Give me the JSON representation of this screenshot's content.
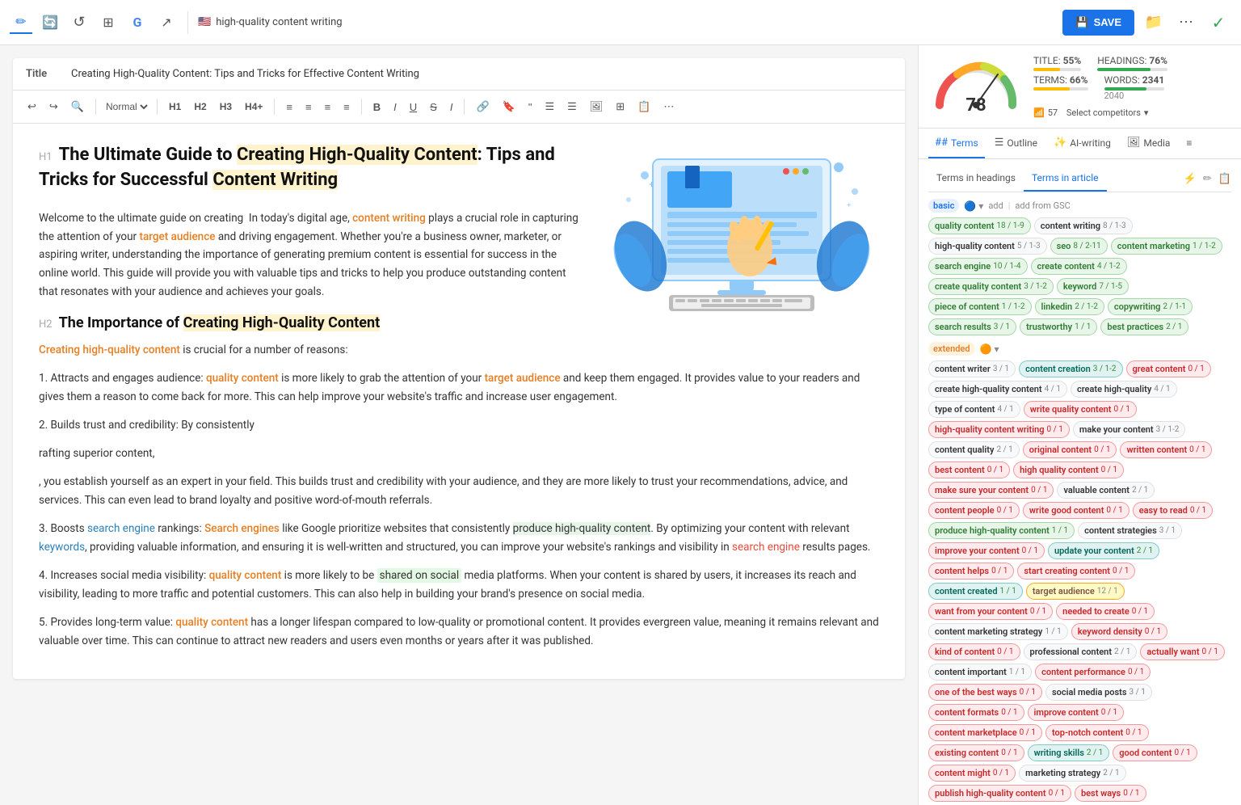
{
  "topbar": {
    "icons": [
      {
        "name": "pen-icon",
        "symbol": "✏️",
        "active": true
      },
      {
        "name": "refresh-icon",
        "symbol": "🔄",
        "active": false
      },
      {
        "name": "history-icon",
        "symbol": "↺",
        "active": false
      },
      {
        "name": "grid-icon",
        "symbol": "⊞",
        "active": false
      },
      {
        "name": "google-icon",
        "symbol": "G",
        "active": false
      },
      {
        "name": "share-icon",
        "symbol": "↗",
        "active": false
      }
    ],
    "flag": "🇺🇸",
    "document_title": "high-quality content writing",
    "save_label": "SAVE",
    "folder_icon": "📁",
    "more_icon": "⋯",
    "check_icon": "✓"
  },
  "title_bar": {
    "label": "Title",
    "value": "Creating High-Quality Content: Tips and Tricks for Effective Content Writing"
  },
  "toolbar": {
    "undo": "↩",
    "redo": "↪",
    "search": "🔍",
    "format": "Normal",
    "h1": "H1",
    "h2": "H2",
    "h3": "H3",
    "h4": "H4+",
    "align_left": "≡",
    "align_center": "≡",
    "align_right": "≡",
    "align_justify": "≡",
    "bold": "B",
    "italic": "I",
    "underline": "U",
    "strikethrough": "S",
    "more": "⋯"
  },
  "content": {
    "h1": "The Ultimate Guide to Creating High-Quality Content: Tips and Tricks for Successful Content Writing",
    "intro": "Welcome to the ultimate guide on creating  In today's digital age, content writing plays a crucial role in capturing the attention of your target audience and driving engagement. Whether you're a business owner, marketer, or aspiring writer, understanding the importance of generating premium content is essential for success in the online world. This guide will provide you with valuable tips and tricks to help you produce outstanding content that resonates with your audience and achieves your goals.",
    "h2": "The Importance of Creating High-Quality Content",
    "body1": "Creating high-quality content is crucial for a number of reasons:",
    "list": [
      "Attracts and engages audience: quality content is more likely to grab the attention of your target audience and keep them engaged. It provides value to your readers and gives them a reason to come back for more. This can help improve your website's traffic and increase user engagement.",
      "Builds trust and credibility: By consistently"
    ],
    "body2": "rafting superior content,",
    "body3": ", you establish yourself as an expert in your field. This builds trust and credibility with your audience, and they are more likely to trust your recommendations, advice, and services. This can even lead to brand loyalty and positive word-of-mouth referrals.",
    "body4": "3. Boosts search engine rankings: Search engines like Google prioritize websites that consistently produce high-quality content. By optimizing your content with relevant keywords, providing valuable information, and ensuring it is well-written and structured, you can improve your website's rankings and visibility in search engine results pages.",
    "body5": "4. Increases social media visibility: quality content is more likely to be shared on social media platforms. When your content is shared by users, it increases its reach and visibility, leading to more traffic and potential customers. This can also help in building your brand's presence on social media.",
    "body6": "5. Provides long-term value: quality content has a longer lifespan compared to low-quality or promotional content. It provides evergreen value, meaning it remains relevant and valuable over time. This can continue to attract new readers and users even months or years after it was published."
  },
  "score": {
    "value": 78,
    "wifi_label": "57",
    "title_pct": "55%",
    "headings_pct": "76%",
    "terms_pct": "66%",
    "words": "2341",
    "words_sub": "2040",
    "select_competitors": "Select competitors"
  },
  "panel_tabs": [
    {
      "label": "Terms",
      "icon": "##",
      "active": true
    },
    {
      "label": "Outline",
      "icon": "☰"
    },
    {
      "label": "AI-writing",
      "icon": "✨"
    },
    {
      "label": "Media",
      "icon": "🖼"
    },
    {
      "label": "≡",
      "icon": ""
    }
  ],
  "terms_subtabs": [
    {
      "label": "Terms in headings"
    },
    {
      "label": "Terms in article",
      "active": true
    }
  ],
  "basic_terms": [
    {
      "key": "quality content",
      "count": "18",
      "range": "1-9",
      "style": "green"
    },
    {
      "key": "content writing",
      "count": "8",
      "range": "1-3",
      "style": "white"
    },
    {
      "key": "high-quality content",
      "count": "5",
      "range": "1-3",
      "style": "white"
    },
    {
      "key": "seo",
      "count": "8",
      "range": "2-11",
      "style": "green"
    },
    {
      "key": "content marketing",
      "count": "1",
      "range": "1-2",
      "style": "green"
    },
    {
      "key": "search engine",
      "count": "10",
      "range": "1-4",
      "style": "green"
    },
    {
      "key": "create content",
      "count": "4",
      "range": "1-2",
      "style": "green"
    },
    {
      "key": "create quality content",
      "count": "3",
      "range": "1-2",
      "style": "green"
    },
    {
      "key": "keyword",
      "count": "7",
      "range": "1-5",
      "style": "green"
    },
    {
      "key": "piece of content",
      "count": "1",
      "range": "1-2",
      "style": "green"
    },
    {
      "key": "linkedin",
      "count": "2",
      "range": "1-2",
      "style": "green"
    },
    {
      "key": "copywriting",
      "count": "2",
      "range": "1-1",
      "style": "green"
    },
    {
      "key": "search results",
      "count": "3",
      "range": "1-1",
      "style": "green"
    },
    {
      "key": "trustworthy",
      "count": "1",
      "range": "1",
      "style": "green"
    },
    {
      "key": "best practices",
      "count": "2",
      "range": "1",
      "style": "green"
    }
  ],
  "extended_terms": [
    {
      "key": "content writer",
      "count": "3",
      "range": "1",
      "style": "white"
    },
    {
      "key": "content creation",
      "count": "3",
      "range": "1-2",
      "style": "teal"
    },
    {
      "key": "great content",
      "count": "0",
      "range": "1",
      "style": "red"
    },
    {
      "key": "create high-quality content",
      "count": "4",
      "range": "1",
      "style": "white"
    },
    {
      "key": "create high-quality",
      "count": "4",
      "range": "1",
      "style": "white"
    },
    {
      "key": "type of content",
      "count": "4",
      "range": "1",
      "style": "white"
    },
    {
      "key": "write quality content",
      "count": "0",
      "range": "1",
      "style": "red"
    },
    {
      "key": "high-quality content writing",
      "count": "0",
      "range": "1",
      "style": "red"
    },
    {
      "key": "make your content",
      "count": "3",
      "range": "1-2",
      "style": "white"
    },
    {
      "key": "content quality",
      "count": "2",
      "range": "1",
      "style": "white"
    },
    {
      "key": "original content",
      "count": "0",
      "range": "1",
      "style": "red"
    },
    {
      "key": "written content",
      "count": "0",
      "range": "1",
      "style": "red"
    },
    {
      "key": "best content",
      "count": "0",
      "range": "1",
      "style": "red"
    },
    {
      "key": "high quality content",
      "count": "0",
      "range": "1",
      "style": "red"
    },
    {
      "key": "make sure your content",
      "count": "0",
      "range": "1",
      "style": "red"
    },
    {
      "key": "valuable content",
      "count": "2",
      "range": "1",
      "style": "white"
    },
    {
      "key": "content people",
      "count": "0",
      "range": "1",
      "style": "red"
    },
    {
      "key": "write good content",
      "count": "0",
      "range": "1",
      "style": "red"
    },
    {
      "key": "easy to read",
      "count": "0",
      "range": "1",
      "style": "red"
    },
    {
      "key": "produce high-quality content",
      "count": "1",
      "range": "1",
      "style": "green"
    },
    {
      "key": "content strategies",
      "count": "3",
      "range": "1",
      "style": "white"
    },
    {
      "key": "improve your content",
      "count": "0",
      "range": "1",
      "style": "red"
    },
    {
      "key": "update your content",
      "count": "2",
      "range": "1",
      "style": "teal"
    },
    {
      "key": "content helps",
      "count": "0",
      "range": "1",
      "style": "red"
    },
    {
      "key": "start creating content",
      "count": "0",
      "range": "1",
      "style": "red"
    },
    {
      "key": "content created",
      "count": "1",
      "range": "1",
      "style": "teal"
    },
    {
      "key": "target audience",
      "count": "12",
      "range": "1",
      "style": "yellow"
    },
    {
      "key": "want from your content",
      "count": "0",
      "range": "1",
      "style": "red"
    },
    {
      "key": "needed to create",
      "count": "0",
      "range": "1",
      "style": "red"
    },
    {
      "key": "content marketing strategy",
      "count": "1",
      "range": "1",
      "style": "white"
    },
    {
      "key": "keyword density",
      "count": "0",
      "range": "1",
      "style": "red"
    },
    {
      "key": "kind of content",
      "count": "0",
      "range": "1",
      "style": "red"
    },
    {
      "key": "professional content",
      "count": "2",
      "range": "1",
      "style": "white"
    },
    {
      "key": "actually want",
      "count": "0",
      "range": "1",
      "style": "red"
    },
    {
      "key": "content important",
      "count": "1",
      "range": "1",
      "style": "white"
    },
    {
      "key": "content performance",
      "count": "0",
      "range": "1",
      "style": "red"
    },
    {
      "key": "one of the best ways",
      "count": "0",
      "range": "1",
      "style": "red"
    },
    {
      "key": "social media posts",
      "count": "3",
      "range": "1",
      "style": "white"
    },
    {
      "key": "content formats",
      "count": "0",
      "range": "1",
      "style": "red"
    },
    {
      "key": "improve content",
      "count": "0",
      "range": "1",
      "style": "red"
    },
    {
      "key": "content marketplace",
      "count": "0",
      "range": "1",
      "style": "red"
    },
    {
      "key": "top-notch content",
      "count": "0",
      "range": "1",
      "style": "red"
    },
    {
      "key": "existing content",
      "count": "0",
      "range": "1",
      "style": "red"
    },
    {
      "key": "writing skills",
      "count": "2",
      "range": "1",
      "style": "teal"
    },
    {
      "key": "good content",
      "count": "0",
      "range": "1",
      "style": "red",
      "note": "0/1"
    },
    {
      "key": "content might",
      "count": "0",
      "range": "1",
      "style": "red"
    },
    {
      "key": "marketing strategy",
      "count": "2",
      "range": "1",
      "style": "white"
    },
    {
      "key": "publish high-quality content",
      "count": "0",
      "range": "1",
      "style": "red"
    },
    {
      "key": "best ways",
      "count": "0",
      "range": "1",
      "style": "red"
    }
  ]
}
